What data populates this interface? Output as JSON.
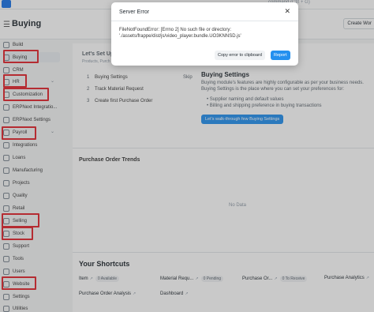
{
  "topbar": {
    "search_hint": "command (Ctrl + G)"
  },
  "header": {
    "title": "Buying",
    "create_label": "Create Wor"
  },
  "sidebar": {
    "items": [
      {
        "label": "Build"
      },
      {
        "label": "Buying"
      },
      {
        "label": "CRM"
      },
      {
        "label": "HR"
      },
      {
        "label": "Customization"
      },
      {
        "label": "ERPNext Integratio..."
      },
      {
        "label": "ERPNext Settings"
      },
      {
        "label": "Payroll"
      },
      {
        "label": "Integrations"
      },
      {
        "label": "Loans"
      },
      {
        "label": "Manufacturing"
      },
      {
        "label": "Projects"
      },
      {
        "label": "Quality"
      },
      {
        "label": "Retail"
      },
      {
        "label": "Selling"
      },
      {
        "label": "Stock"
      },
      {
        "label": "Support"
      },
      {
        "label": "Tools"
      },
      {
        "label": "Users"
      },
      {
        "label": "Website"
      },
      {
        "label": "Settings"
      },
      {
        "label": "Utilities"
      }
    ],
    "highlight_color": "#e3262e"
  },
  "setup": {
    "title": "Let's Set Up",
    "subtitle": "Products, Purch",
    "steps": [
      {
        "num": "1",
        "label": "Buying Settings"
      },
      {
        "num": "2",
        "label": "Track Material Request"
      },
      {
        "num": "3",
        "label": "Create first Purchase Order"
      }
    ],
    "skip_label": "Skip"
  },
  "buying_settings": {
    "title": "Buying Settings",
    "description": "Buying module's features are highly configurable as per your business needs. Buying Settings is the place where you can set your preferences for:",
    "bullets": [
      "Supplier naming and default values",
      "Billing and shipping preference in buying transactions"
    ],
    "walkthrough_label": "Let's walk-through few Buying Settings",
    "accent": "#2490ef"
  },
  "trends": {
    "title": "Purchase Order Trends",
    "empty_text": "No Data"
  },
  "shortcuts": {
    "title": "Your Shortcuts",
    "items": [
      {
        "label": "Item",
        "badge": "0 Available"
      },
      {
        "label": "Material Requ...",
        "badge": "0 Pending"
      },
      {
        "label": "Purchase Or...",
        "badge": "0 To Receive"
      },
      {
        "label": "Purchase Analytics",
        "badge": ""
      },
      {
        "label": "Purchase Order Analysis",
        "badge": ""
      },
      {
        "label": "Dashboard",
        "badge": ""
      }
    ]
  },
  "modal": {
    "title": "Server Error",
    "message": "FileNotFoundError: [Errno 2] No such file or directory: './assets/frappe/dist/js/video_player.bundle.UO3KNNSD.js'",
    "copy_label": "Copy error to clipboard",
    "report_label": "Report"
  }
}
